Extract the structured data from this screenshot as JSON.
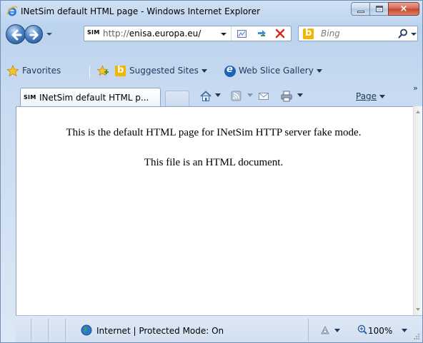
{
  "window": {
    "title": "INetSim default HTML page - Windows Internet Explorer",
    "buttons": {
      "minimize": "minimize",
      "maximize": "maximize",
      "close": "×"
    }
  },
  "address_bar": {
    "site_badge": "SIM",
    "url_scheme": "http://",
    "url_host": "enisa.europa.eu/"
  },
  "search": {
    "provider_letter": "b",
    "placeholder": "Bing"
  },
  "favorites_bar": {
    "favorites_label": "Favorites",
    "items": [
      {
        "label": "Suggested Sites",
        "icon": "bing-icon"
      },
      {
        "label": "Web Slice Gallery",
        "icon": "ie-icon"
      }
    ],
    "bing_letter": "b",
    "ie_letter": "e"
  },
  "tabs": [
    {
      "badge": "SIM",
      "label": "INetSim default HTML p..."
    }
  ],
  "command_bar": {
    "page_label": "Page",
    "more_glyph": "»"
  },
  "content": {
    "line1": "This is the default HTML page for INetSim HTTP server fake mode.",
    "line2": "This file is an HTML document."
  },
  "status_bar": {
    "zone_text": "Internet | Protected Mode: On",
    "zoom": "100%"
  },
  "colors": {
    "chrome_bg": "#c9dbf0",
    "close_red": "#c4432c",
    "bing_yellow": "#f5b400",
    "ie_blue": "#1f62b6"
  }
}
